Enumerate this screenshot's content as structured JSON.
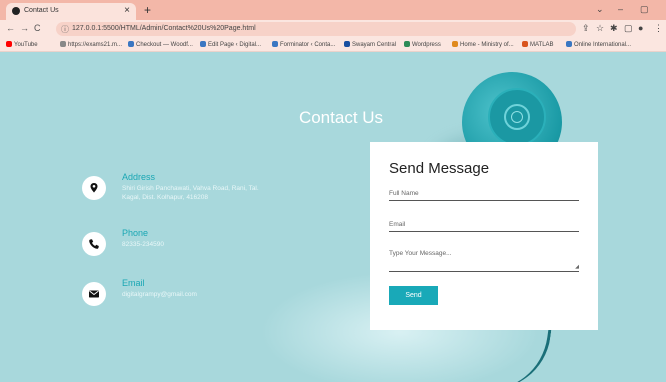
{
  "browser": {
    "tab_title": "Contact Us",
    "tab_close": "×",
    "new_tab": "+",
    "window_controls": [
      "⌄",
      "–",
      "▢"
    ],
    "url": "127.0.0.1:5500/HTML/Admin/Contact%20Us%20Page.html",
    "nav": {
      "back": "←",
      "forward": "→",
      "reload": "C"
    },
    "toolbar_right": [
      "⇪",
      "☆",
      "✱",
      "▢",
      "●",
      "⋮"
    ],
    "bookmarks": [
      {
        "label": "YouTube",
        "color": "#ff0000"
      },
      {
        "label": "https://exams21.m...",
        "color": "#888888"
      },
      {
        "label": "Checkout — Woodf...",
        "color": "#3b77c2"
      },
      {
        "label": "Edit Page ‹ Digital...",
        "color": "#3b77c2"
      },
      {
        "label": "Forminator ‹ Conta...",
        "color": "#3b77c2"
      },
      {
        "label": "Swayam Central",
        "color": "#1a4fa0"
      },
      {
        "label": "Wordpress",
        "color": "#2e8b57"
      },
      {
        "label": "Home - Ministry of...",
        "color": "#e08a1e"
      },
      {
        "label": "MATLAB",
        "color": "#d9541e"
      },
      {
        "label": "Online International...",
        "color": "#3b77c2"
      }
    ]
  },
  "page": {
    "title": "Contact Us",
    "contact": {
      "address": {
        "label": "Address",
        "text": "Shiri Girish Panchawati, Vahva Road, Rani, Tal. Kagal, Dist. Kolhapur, 416208"
      },
      "phone": {
        "label": "Phone",
        "text": "82335-234590"
      },
      "email": {
        "label": "Email",
        "text": "digitalgrampy@gmail.com"
      }
    },
    "form": {
      "title": "Send Message",
      "full_name_placeholder": "Full Name",
      "email_placeholder": "Email",
      "message_placeholder": "Type Your Message...",
      "send_label": "Send"
    },
    "colors": {
      "background": "#a8d8dc",
      "accent": "#19a9b8"
    }
  }
}
